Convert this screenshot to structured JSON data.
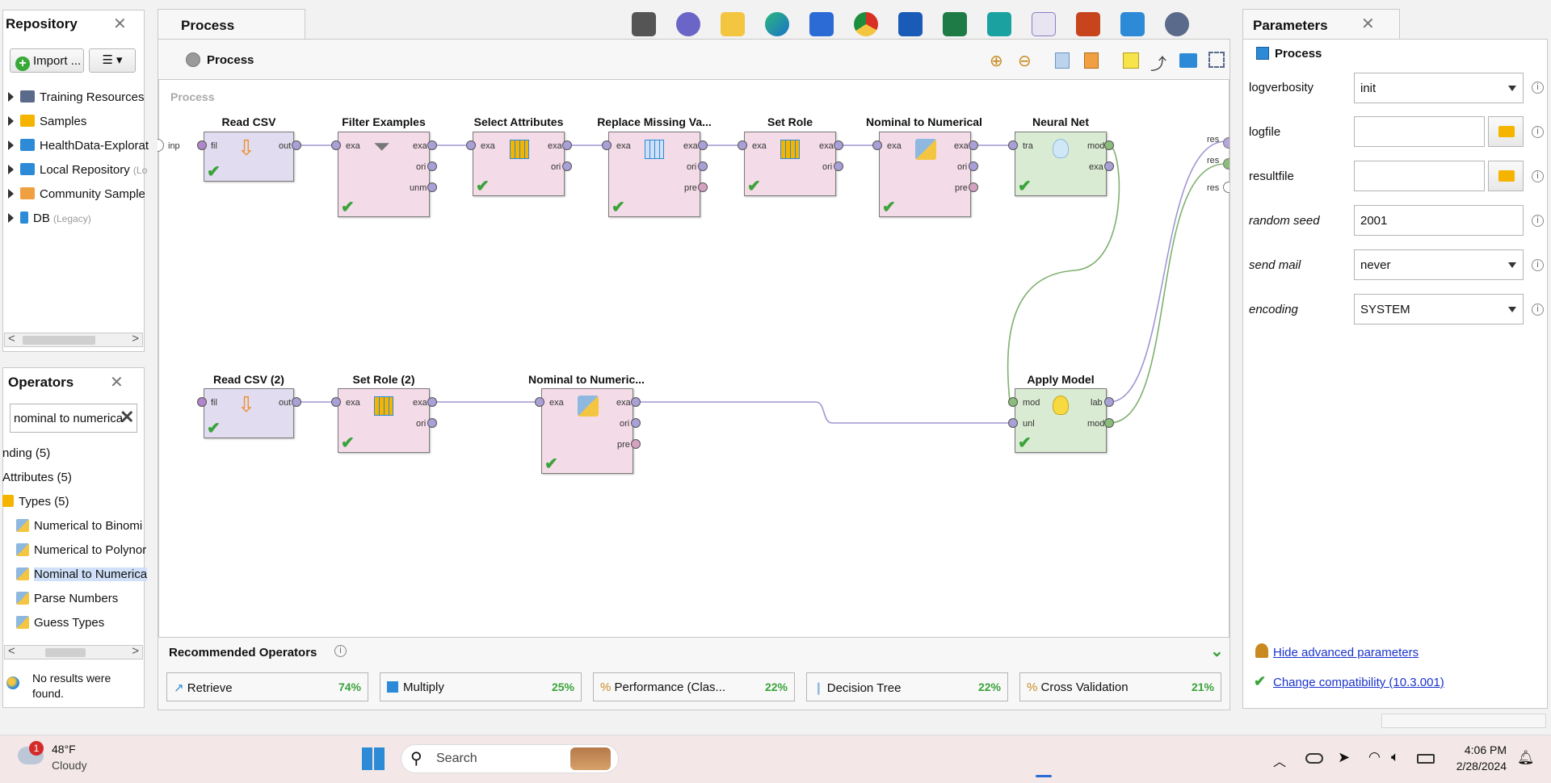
{
  "repository": {
    "title": "Repository",
    "import_label": "Import ...",
    "menu_label": "☰ ▾",
    "items": [
      {
        "label": "Training Resources",
        "suffix": ""
      },
      {
        "label": "Samples",
        "suffix": ""
      },
      {
        "label": "HealthData-Explorat",
        "suffix": ""
      },
      {
        "label": "Local Repository",
        "suffix": "(Lo"
      },
      {
        "label": "Community Sample",
        "suffix": ""
      },
      {
        "label": "DB",
        "suffix": "(Legacy)"
      }
    ]
  },
  "operators": {
    "title": "Operators",
    "search_value": "nominal to numerica",
    "items": [
      {
        "label": "nding (5)"
      },
      {
        "label": "Attributes (5)"
      },
      {
        "label": "Types (5)"
      },
      {
        "label": "Numerical to Binomi"
      },
      {
        "label": "Numerical to Polynor"
      },
      {
        "label": "Nominal to Numerica"
      },
      {
        "label": "Parse Numbers"
      },
      {
        "label": "Guess Types"
      }
    ],
    "no_results": "No results were found."
  },
  "process": {
    "tab_label": "Process",
    "header_label": "Process",
    "canvas_label": "Process",
    "nodes": {
      "read_csv": {
        "title": "Read CSV",
        "ports_in": [
          "fil"
        ],
        "ports_out": [
          "out"
        ]
      },
      "filter_examples": {
        "title": "Filter Examples",
        "ports_in": [
          "exa"
        ],
        "ports_out": [
          "exa",
          "ori",
          "unm"
        ]
      },
      "select_attributes": {
        "title": "Select Attributes",
        "ports_in": [
          "exa"
        ],
        "ports_out": [
          "exa",
          "ori"
        ]
      },
      "replace_missing": {
        "title": "Replace Missing Va...",
        "ports_in": [
          "exa"
        ],
        "ports_out": [
          "exa",
          "ori",
          "pre"
        ]
      },
      "set_role": {
        "title": "Set Role",
        "ports_in": [
          "exa"
        ],
        "ports_out": [
          "exa",
          "ori"
        ]
      },
      "nom_to_num": {
        "title": "Nominal to Numerical",
        "ports_in": [
          "exa"
        ],
        "ports_out": [
          "exa",
          "ori",
          "pre"
        ]
      },
      "neural_net": {
        "title": "Neural Net",
        "ports_in": [
          "tra"
        ],
        "ports_out": [
          "mod",
          "exa"
        ]
      },
      "read_csv2": {
        "title": "Read CSV (2)",
        "ports_in": [
          "fil"
        ],
        "ports_out": [
          "out"
        ]
      },
      "set_role2": {
        "title": "Set Role (2)",
        "ports_in": [
          "exa"
        ],
        "ports_out": [
          "exa",
          "ori"
        ]
      },
      "nom_to_num2": {
        "title": "Nominal to Numeric...",
        "ports_in": [
          "exa"
        ],
        "ports_out": [
          "exa",
          "ori",
          "pre"
        ]
      },
      "apply_model": {
        "title": "Apply Model",
        "ports_in": [
          "mod",
          "unl"
        ],
        "ports_out": [
          "lab",
          "mod"
        ]
      }
    },
    "inp_label": "inp",
    "res_labels": [
      "res",
      "res",
      "res"
    ]
  },
  "recommended": {
    "title": "Recommended Operators",
    "items": [
      {
        "label": "Retrieve",
        "pct": "74%"
      },
      {
        "label": "Multiply",
        "pct": "25%"
      },
      {
        "label": "Performance (Clas...",
        "pct": "22%"
      },
      {
        "label": "Decision Tree",
        "pct": "22%"
      },
      {
        "label": "Cross Validation",
        "pct": "21%"
      }
    ]
  },
  "parameters": {
    "title": "Parameters",
    "subtitle": "Process",
    "rows": [
      {
        "label": "logverbosity",
        "value": "init"
      },
      {
        "label": "logfile",
        "value": ""
      },
      {
        "label": "resultfile",
        "value": ""
      },
      {
        "label": "random seed",
        "value": "2001"
      },
      {
        "label": "send mail",
        "value": "never"
      },
      {
        "label": "encoding",
        "value": "SYSTEM"
      }
    ],
    "hide_advanced": "Hide advanced parameters",
    "compatibility": "Change compatibility (10.3.001)"
  },
  "taskbar": {
    "weather_temp": "48°F",
    "weather_desc": "Cloudy",
    "weather_badge": "1",
    "search_placeholder": "Search",
    "time": "4:06 PM",
    "date": "2/28/2024"
  },
  "colors": {
    "node_pink": "#f3dbe7",
    "node_lavender": "#e1dcef",
    "node_green": "#d9ebd2",
    "check_green": "#3aa33a",
    "link_blue": "#1a33cc"
  }
}
